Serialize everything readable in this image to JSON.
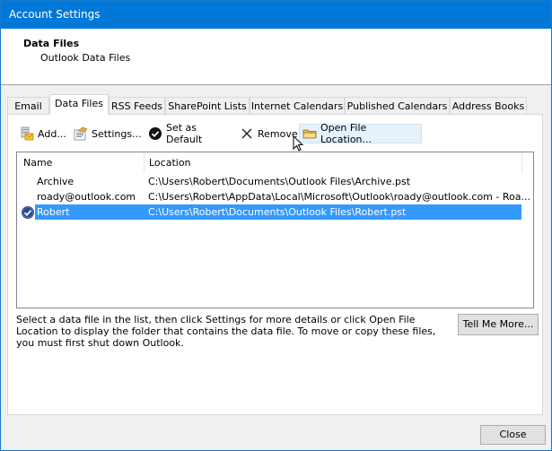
{
  "window": {
    "title": "Account Settings"
  },
  "header": {
    "title": "Data Files",
    "subtitle": "Outlook Data Files"
  },
  "tabs": [
    {
      "label": "Email",
      "active": false
    },
    {
      "label": "Data Files",
      "active": true
    },
    {
      "label": "RSS Feeds",
      "active": false
    },
    {
      "label": "SharePoint Lists",
      "active": false
    },
    {
      "label": "Internet Calendars",
      "active": false
    },
    {
      "label": "Published Calendars",
      "active": false
    },
    {
      "label": "Address Books",
      "active": false
    }
  ],
  "toolbar": {
    "add": {
      "label": "Add...",
      "icon": "add-data-file-icon"
    },
    "settings": {
      "label": "Settings...",
      "icon": "settings-icon"
    },
    "set_default": {
      "label": "Set as Default",
      "icon": "checkmark-circle-icon"
    },
    "remove": {
      "label": "Remove",
      "icon": "x-icon"
    },
    "open_location": {
      "label": "Open File Location...",
      "icon": "folder-icon"
    }
  },
  "list": {
    "columns": [
      "Name",
      "Location"
    ],
    "rows": [
      {
        "name": "Archive",
        "location": "C:\\Users\\Robert\\Documents\\Outlook Files\\Archive.pst",
        "default": false,
        "selected": false
      },
      {
        "name": "roady@outlook.com",
        "location": "C:\\Users\\Robert\\AppData\\Local\\Microsoft\\Outlook\\roady@outlook.com - Roa...",
        "default": false,
        "selected": false
      },
      {
        "name": "Robert",
        "location": "C:\\Users\\Robert\\Documents\\Outlook Files\\Robert.pst",
        "default": true,
        "selected": true
      }
    ]
  },
  "description": "Select a data file in the list, then click Settings for more details or click Open File Location to display the folder that contains the data file. To move or copy these files, you must first shut down Outlook.",
  "buttons": {
    "tell_me_more": "Tell Me More...",
    "close": "Close"
  },
  "colors": {
    "titlebar": "#0078d7",
    "selection": "#3399ff",
    "hover": "#e5f1fb"
  }
}
